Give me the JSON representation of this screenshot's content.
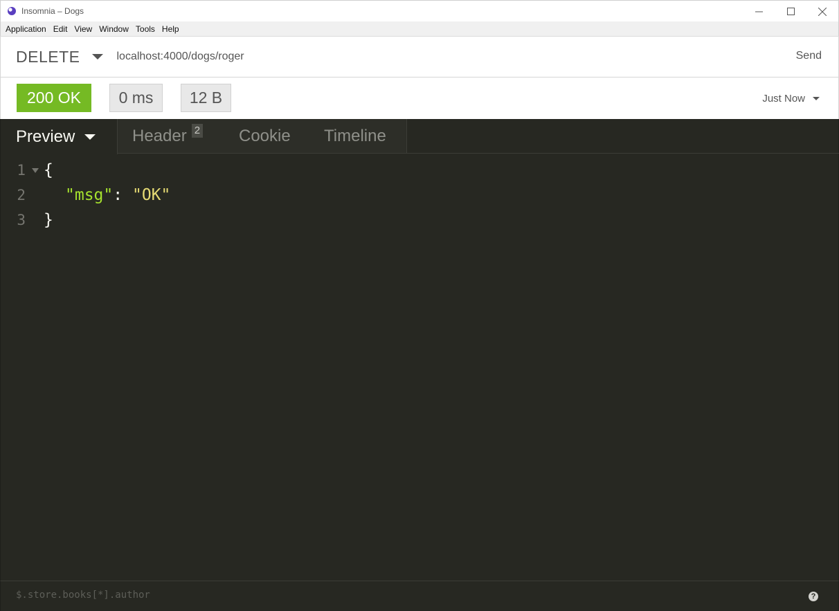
{
  "window": {
    "title": "Insomnia – Dogs"
  },
  "menu": {
    "items": [
      "Application",
      "Edit",
      "View",
      "Window",
      "Tools",
      "Help"
    ]
  },
  "request": {
    "method": "DELETE",
    "url": "localhost:4000/dogs/roger",
    "send_label": "Send"
  },
  "response": {
    "status": "200 OK",
    "time": "0 ms",
    "size": "12 B",
    "history_label": "Just Now",
    "tabs": {
      "preview": "Preview",
      "header": "Header",
      "header_count": "2",
      "cookie": "Cookie",
      "timeline": "Timeline"
    },
    "body": {
      "line_numbers": [
        "1",
        "2",
        "3"
      ],
      "open_brace": "{",
      "key": "\"msg\"",
      "colon": ":",
      "value": "\"OK\"",
      "close_brace": "}"
    },
    "filter_placeholder": "$.store.books[*].author"
  },
  "colors": {
    "status_ok": "#75ba24",
    "editor_bg": "#272822",
    "json_key": "#a6e22e",
    "json_string": "#e6db74",
    "app_accent": "#5a3fc0"
  },
  "icons": {
    "app": "insomnia-logo-icon",
    "minimize": "minimize-icon",
    "maximize": "maximize-icon",
    "close": "close-icon",
    "method_dropdown": "chevron-down-icon",
    "history_dropdown": "chevron-down-icon",
    "help": "help-icon"
  }
}
